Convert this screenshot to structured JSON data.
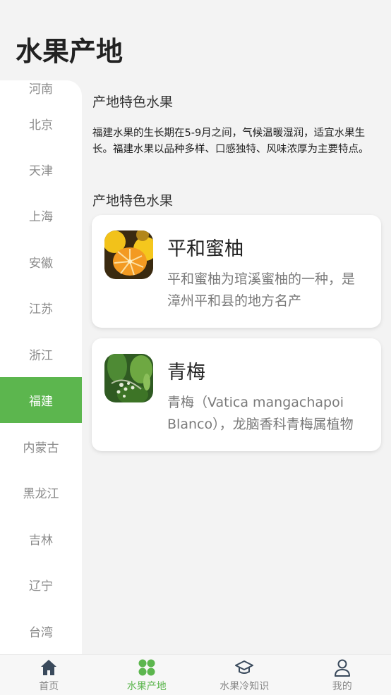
{
  "header": {
    "title": "水果产地"
  },
  "sidebar": {
    "items": [
      {
        "label": "河南"
      },
      {
        "label": "北京"
      },
      {
        "label": "天津"
      },
      {
        "label": "上海"
      },
      {
        "label": "安徽"
      },
      {
        "label": "江苏"
      },
      {
        "label": "浙江"
      },
      {
        "label": "福建",
        "active": true
      },
      {
        "label": "内蒙古"
      },
      {
        "label": "黑龙江"
      },
      {
        "label": "吉林"
      },
      {
        "label": "辽宁"
      },
      {
        "label": "台湾"
      }
    ]
  },
  "main": {
    "intro_heading": "产地特色水果",
    "intro_text": "福建水果的生长期在5-9月之间，气候温暖湿润，适宜水果生长。福建水果以品种多样、口感独特、风味浓厚为主要特点。",
    "list_heading": "产地特色水果",
    "fruits": [
      {
        "name": "平和蜜柚",
        "summary": "平和蜜柚为琯溪蜜柚的一种，是漳州平和县的地方名产"
      },
      {
        "name": "青梅",
        "summary": "青梅（Vatica mangachapoi Blanco），龙脑香科青梅属植物"
      }
    ]
  },
  "bottom_nav": {
    "items": [
      {
        "label": "首页",
        "icon": "home-icon"
      },
      {
        "label": "水果产地",
        "icon": "grid-icon",
        "active": true
      },
      {
        "label": "水果冷知识",
        "icon": "graduation-cap-icon"
      },
      {
        "label": "我的",
        "icon": "user-icon"
      }
    ]
  },
  "colors": {
    "accent": "#5cb64e",
    "background": "#f3f3f3"
  }
}
